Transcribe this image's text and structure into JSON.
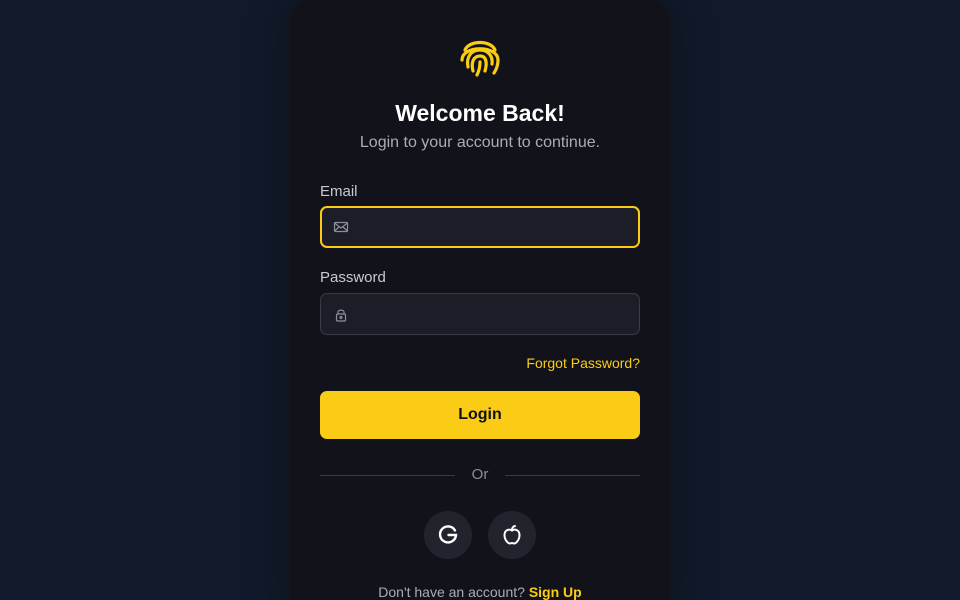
{
  "header": {
    "logo_icon": "fingerprint-icon",
    "title": "Welcome Back!",
    "subtitle": "Login to your account to continue."
  },
  "form": {
    "email": {
      "label": "Email",
      "value": "",
      "placeholder": "",
      "icon": "mail-icon"
    },
    "password": {
      "label": "Password",
      "value": "",
      "placeholder": "",
      "icon": "lock-icon"
    },
    "forgot_label": "Forgot Password?",
    "login_label": "Login"
  },
  "divider": {
    "label": "Or"
  },
  "social": [
    {
      "name": "google",
      "icon": "google-icon"
    },
    {
      "name": "apple",
      "icon": "apple-icon"
    }
  ],
  "footer": {
    "prompt": "Don't have an account?",
    "signup_label": "Sign Up"
  },
  "colors": {
    "background": "#111a2a",
    "card": "#12131a",
    "accent": "#facc15",
    "input_bg": "#1d1d28"
  }
}
